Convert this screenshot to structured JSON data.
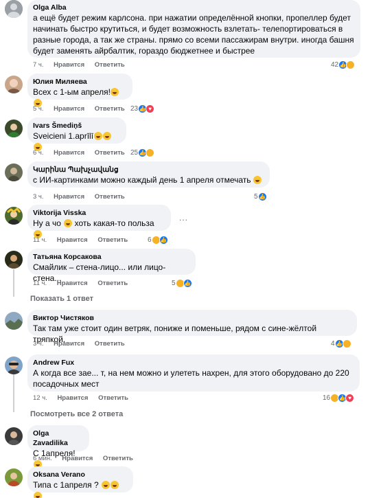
{
  "comments": [
    {
      "name": "Olga Alba",
      "lines": [
        "а ещё будет режим карлсона. при нажатии определённой кнопки, пропеллер будет",
        "начинать быстро крутиться, и будет возможность взлетать- телепортироваться в",
        "разные города, а так же страны. прямо со всеми пассажирам внутри. иногда башня",
        "будет заменять айрбалтик, гораздо бюджетнее и быстрее"
      ],
      "time": "7 ч.",
      "like": "Нравится",
      "reply": "Ответить",
      "reactions": "42"
    },
    {
      "name": "Юлия Миляева",
      "text": "Всех с 1-ым апреля!",
      "time": "5 ч.",
      "like": "Нравится",
      "reply": "Ответить",
      "reactions": "23"
    },
    {
      "name": "Ivars Šmediņš",
      "text": "Sveicieni 1.aprīlī",
      "time": "6 ч.",
      "like": "Нравится",
      "reply": "Ответить",
      "reactions": "25"
    },
    {
      "name": "Կարինա Պախչավանց",
      "text": "с ИИ-картинками можно каждый день 1 апреля отмечать",
      "time": "3 ч.",
      "like": "Нравится",
      "reply": "Ответить",
      "reactions": "5"
    },
    {
      "name": "Viktorija Visska",
      "text_before": "Ну а чо",
      "text_after": "хоть какая-то польза",
      "time": "11 ч.",
      "like": "Нравится",
      "reply": "Ответить",
      "reactions": "6",
      "more": "..."
    },
    {
      "name": "Татьяна Корсакова",
      "text": "Смайлик – стена-лицо... или лицо-стена...",
      "time": "11 ч.",
      "like": "Нравится",
      "reply": "Ответить",
      "reactions": "5"
    },
    {
      "name": "Виктор Чистяков",
      "text": "Так там уже стоит один ветряк, пониже и поменьше, рядом с сине-жёлтой тряпкой.",
      "time": "3 ч.",
      "like": "Нравится",
      "reply": "Ответить",
      "reactions": "4"
    },
    {
      "name": "Andrew Fux",
      "lines": [
        "А когда все зае... т, на нем можно и улететь нахрен, для этого оборудовано до 220",
        "посадочных мест"
      ],
      "time": "12 ч.",
      "like": "Нравится",
      "reply": "Ответить",
      "reactions": "16"
    },
    {
      "name": "Olga Zavadilika",
      "text": "С 1апреля!",
      "time": "6 мин.",
      "like": "Нравится",
      "reply": "Ответить",
      "reactions": ""
    },
    {
      "name": "Oksana Verano",
      "text": "Типа с 1апреля ?",
      "time": "",
      "like": "",
      "reply": "",
      "reactions": ""
    }
  ],
  "links": {
    "show_one_reply": "Показать 1 ответ",
    "show_all_replies": "Посмотреть все 2 ответа"
  },
  "colors": {
    "bubble": "#f0f2f5",
    "meta": "#65676b",
    "like": "#1877f2",
    "love": "#f33e58",
    "haha": "#f7b125"
  }
}
